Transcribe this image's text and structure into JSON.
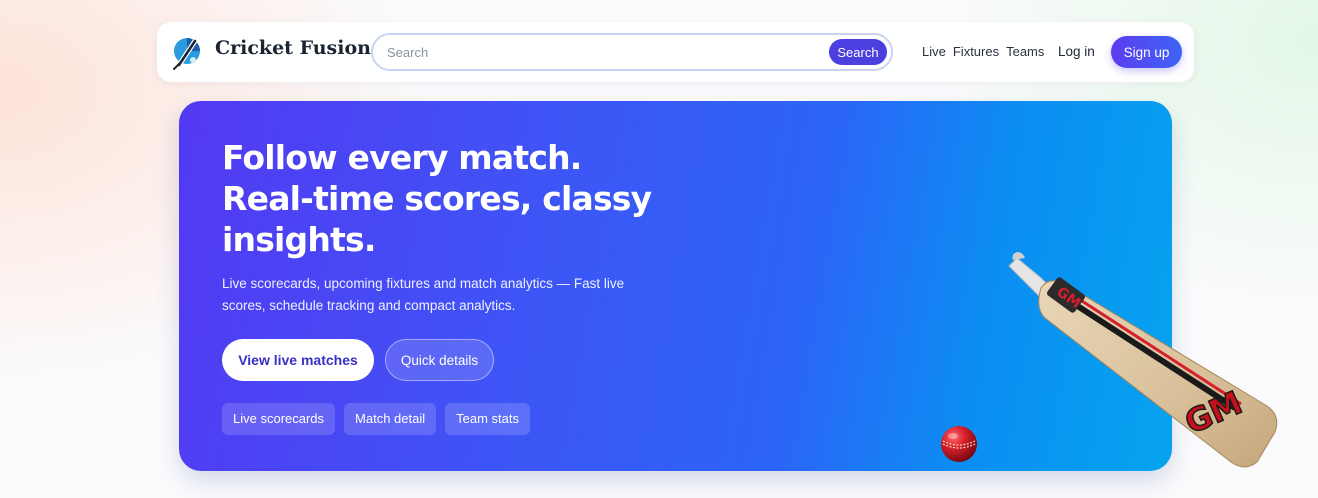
{
  "header": {
    "brand": "Cricket Fusion",
    "logo_icon": "cricket-bat-ball-logo",
    "search": {
      "placeholder": "Search",
      "value": "",
      "button_label": "Search"
    },
    "nav_links": [
      "Live",
      "Fixtures",
      "Teams"
    ],
    "login_label": "Log in",
    "signup_label": "Sign up"
  },
  "hero": {
    "title_lines": [
      "Follow every match.",
      "Real-time scores, classy",
      "insights."
    ],
    "subtitle": "Live scorecards, upcoming fixtures and match analytics — Fast live scores, schedule tracking and compact analytics.",
    "primary_button": "View live matches",
    "secondary_button": "Quick details",
    "chips": [
      "Live scorecards",
      "Match detail",
      "Team stats"
    ],
    "bat_brand": "GM",
    "images": [
      "cricket-ball",
      "cricket-bat"
    ]
  },
  "colors": {
    "accent": "#4b3fe0",
    "hero_gradient_start": "#5339f2",
    "hero_gradient_end": "#06a3ef"
  }
}
